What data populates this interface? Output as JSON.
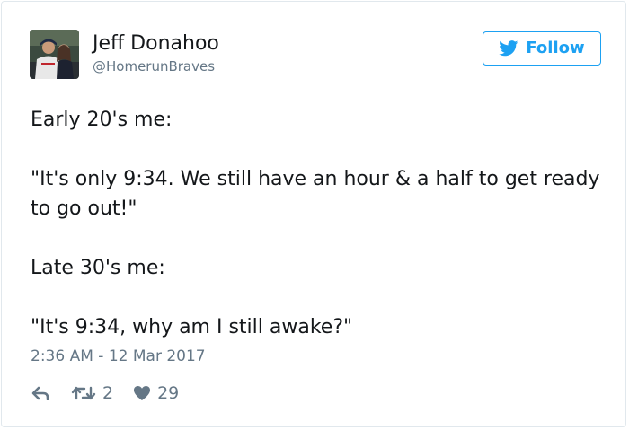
{
  "author": {
    "display_name": "Jeff Donahoo",
    "screen_name": "@HomerunBraves"
  },
  "follow_button": {
    "label": "Follow",
    "icon": "twitter-bird-icon"
  },
  "tweet": {
    "paragraphs": [
      "Early 20's me:",
      "\"It's only 9:34. We still have an hour & a half to get ready to go out!\"",
      "Late 30's me:",
      "\"It's 9:34, why am I still awake?\""
    ],
    "timestamp": "2:36 AM - 12 Mar 2017"
  },
  "actions": {
    "reply": {
      "icon": "reply-icon"
    },
    "retweet": {
      "icon": "retweet-icon",
      "count": "2"
    },
    "like": {
      "icon": "heart-icon",
      "count": "29"
    }
  },
  "colors": {
    "accent": "#1da1f2",
    "text": "#14171a",
    "muted": "#657786",
    "border": "#e1e8ed"
  }
}
